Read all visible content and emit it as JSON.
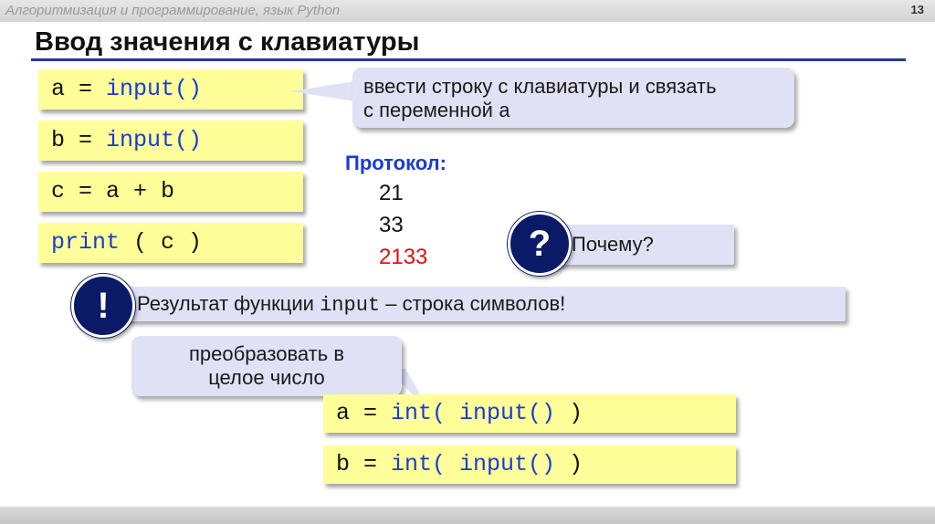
{
  "header": {
    "course": "Алгоритмизация и программирование, язык Python",
    "page_number": "13"
  },
  "title": "Ввод значения с клавиатуры",
  "code_left": [
    {
      "prefix": "a = ",
      "keyword": "input()",
      "suffix": ""
    },
    {
      "prefix": "b = ",
      "keyword": "input()",
      "suffix": ""
    },
    {
      "prefix": "c = a + b",
      "keyword": "",
      "suffix": ""
    },
    {
      "prefix": "",
      "keyword": "print",
      "suffix": " ( c )"
    }
  ],
  "callout_input": {
    "line1": "ввести строку с клавиатуры и связать",
    "line2_text": "с переменной ",
    "line2_var": "a"
  },
  "protocol": {
    "label": "Протокол:",
    "lines": [
      "21",
      "33",
      "2133"
    ]
  },
  "why": {
    "badge": "?",
    "text": "Почему?"
  },
  "result": {
    "badge": "!",
    "text_before": "Результат функции ",
    "code": "input",
    "text_after": " – строка символов!"
  },
  "convert_callout": {
    "line1": "преобразовать в",
    "line2": "целое число"
  },
  "code_right": [
    {
      "prefix": "a = ",
      "kw1": "int(",
      "kw2": " input()",
      "suffix": " )"
    },
    {
      "prefix": "b = ",
      "kw1": "int(",
      "kw2": " input()",
      "suffix": " )"
    }
  ],
  "colors": {
    "accent_blue": "#1a3bd6",
    "code_bg": "#ffff99",
    "callout_bg": "#e0e1f5",
    "badge_bg": "#0a1a66",
    "highlight_red": "#e01010"
  }
}
